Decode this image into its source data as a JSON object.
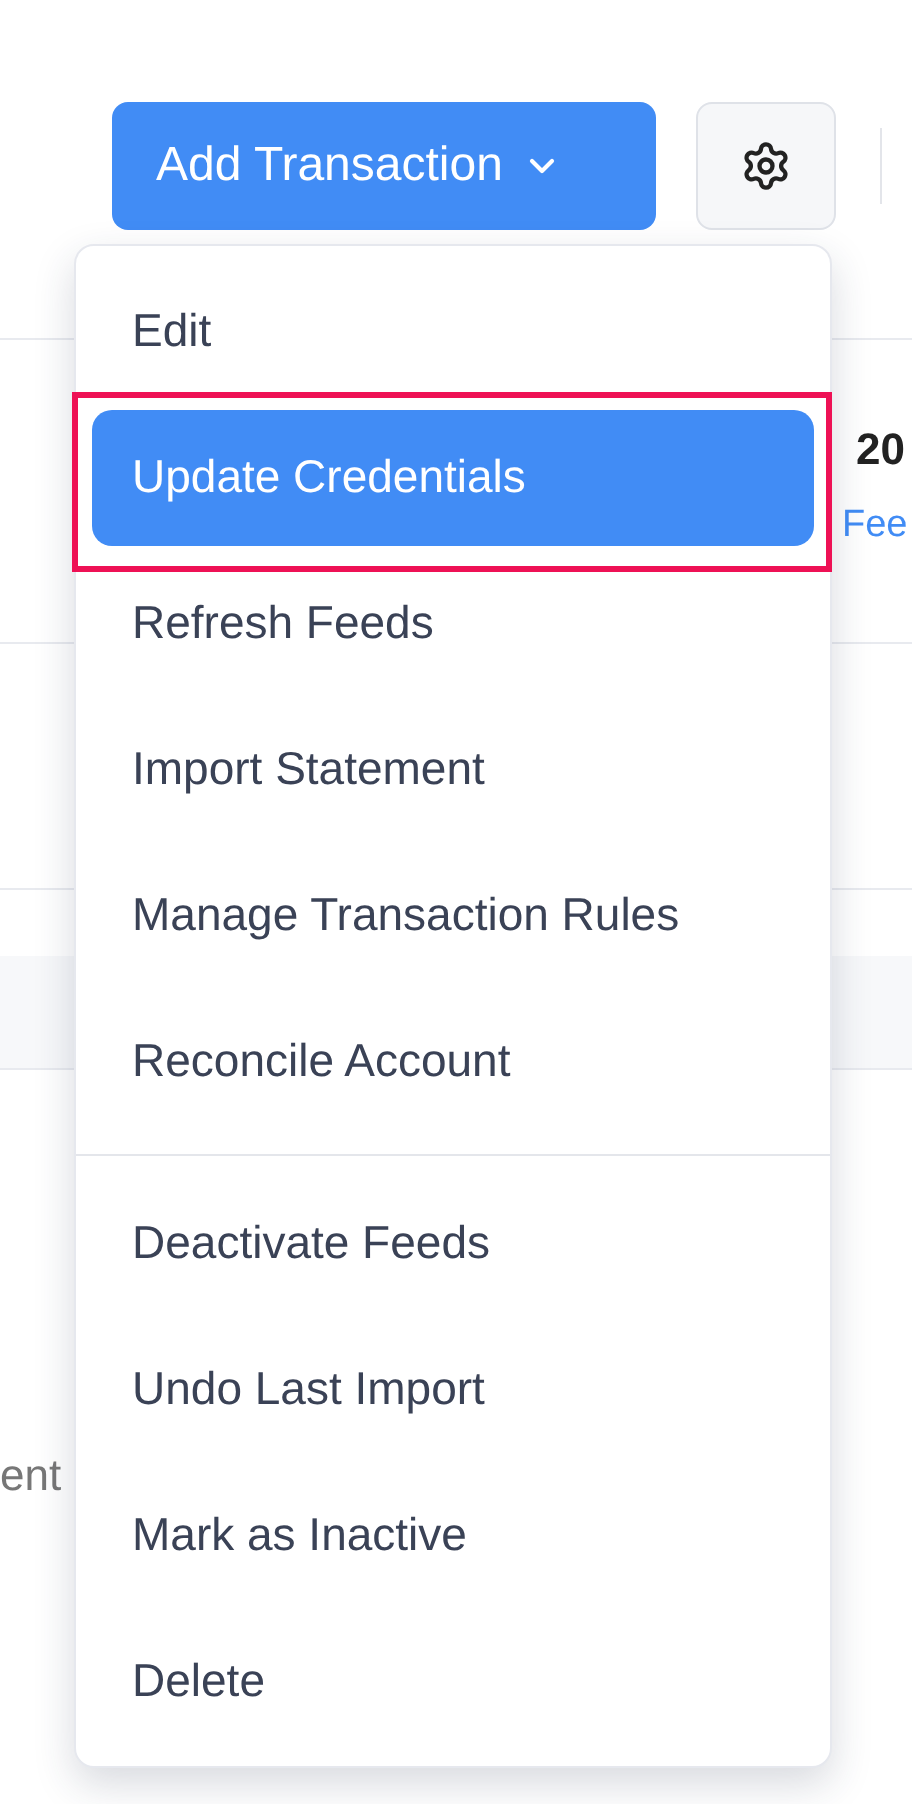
{
  "toolbar": {
    "add_button": {
      "label": "Add Transaction"
    }
  },
  "background": {
    "amount": "20",
    "link": "Fee",
    "side_text": "ent"
  },
  "menu": {
    "groups": [
      [
        {
          "label": "Edit",
          "selected": false
        },
        {
          "label": "Update Credentials",
          "selected": true,
          "annotated": true
        },
        {
          "label": "Refresh Feeds",
          "selected": false
        },
        {
          "label": "Import Statement",
          "selected": false
        },
        {
          "label": "Manage Transaction Rules",
          "selected": false
        },
        {
          "label": "Reconcile Account",
          "selected": false
        }
      ],
      [
        {
          "label": "Deactivate Feeds",
          "selected": false
        },
        {
          "label": "Undo Last Import",
          "selected": false
        },
        {
          "label": "Mark as Inactive",
          "selected": false
        },
        {
          "label": "Delete",
          "selected": false
        }
      ]
    ]
  }
}
